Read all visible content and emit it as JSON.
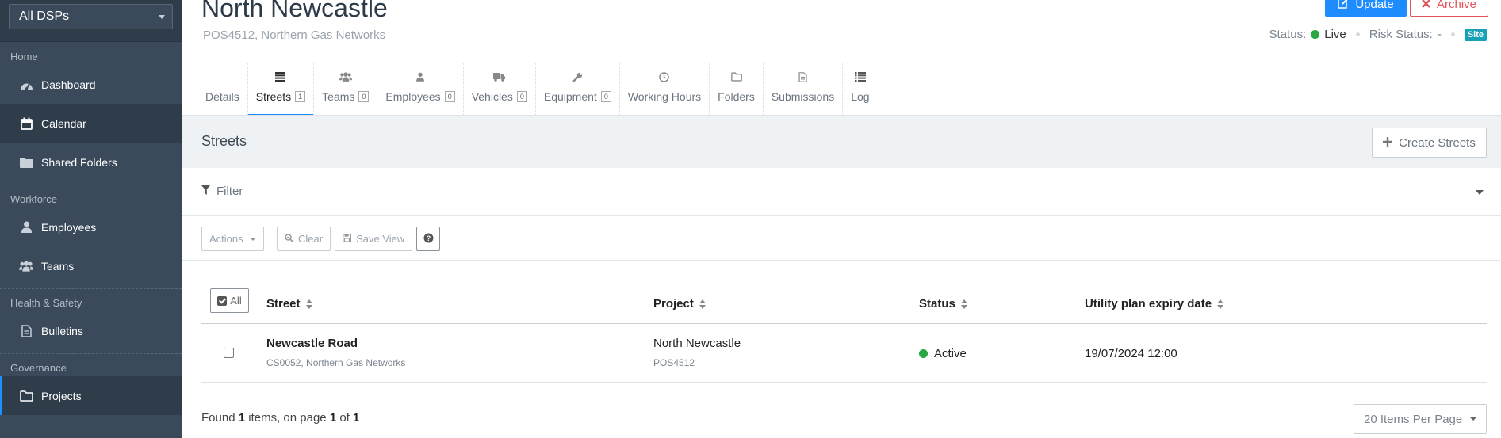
{
  "sidebar": {
    "dsp_select": "All DSPs",
    "sections": {
      "home": "Home",
      "workforce": "Workforce",
      "health_safety": "Health & Safety",
      "governance": "Governance"
    },
    "items": {
      "dashboard": "Dashboard",
      "calendar": "Calendar",
      "shared_folders": "Shared Folders",
      "employees": "Employees",
      "teams": "Teams",
      "bulletins": "Bulletins",
      "projects": "Projects"
    },
    "active_item": "Projects"
  },
  "header": {
    "title": "North Newcastle",
    "subtitle": "POS4512, Northern Gas Networks",
    "update_label": "Update",
    "archive_label": "Archive",
    "status_label": "Status:",
    "status_value": "Live",
    "status_color": "#28a745",
    "risk_label": "Risk Status:",
    "risk_value": "-",
    "site_badge": "Site"
  },
  "tabs": [
    {
      "label": "Details",
      "count": null,
      "icon": "none"
    },
    {
      "label": "Streets",
      "count": "1",
      "icon": "list-icon",
      "active": true
    },
    {
      "label": "Teams",
      "count": "0",
      "icon": "users-icon"
    },
    {
      "label": "Employees",
      "count": "0",
      "icon": "user-icon"
    },
    {
      "label": "Vehicles",
      "count": "0",
      "icon": "truck-icon"
    },
    {
      "label": "Equipment",
      "count": "0",
      "icon": "wrench-icon"
    },
    {
      "label": "Working Hours",
      "count": null,
      "icon": "clock-icon"
    },
    {
      "label": "Folders",
      "count": null,
      "icon": "folder-icon"
    },
    {
      "label": "Submissions",
      "count": null,
      "icon": "document-icon"
    },
    {
      "label": "Log",
      "count": null,
      "icon": "list-bullets-icon"
    }
  ],
  "streets": {
    "title": "Streets",
    "create_label": "Create Streets",
    "filter_label": "Filter",
    "toolbar": {
      "actions": "Actions",
      "clear": "Clear",
      "save_view": "Save View"
    },
    "table": {
      "select_all": "All",
      "columns": [
        "Street",
        "Project",
        "Status",
        "Utility plan expiry date"
      ],
      "rows": [
        {
          "street": "Newcastle Road",
          "street_sub": "CS0052, Northern Gas Networks",
          "project": "North Newcastle",
          "project_sub": "POS4512",
          "status": "Active",
          "status_color": "#28a745",
          "expiry": "19/07/2024 12:00"
        }
      ]
    },
    "footer": {
      "found_prefix": "Found",
      "count": "1",
      "items_on_page": "items, on page",
      "page": "1",
      "of": "of",
      "total_pages": "1",
      "per_page": "20 Items Per Page"
    }
  }
}
